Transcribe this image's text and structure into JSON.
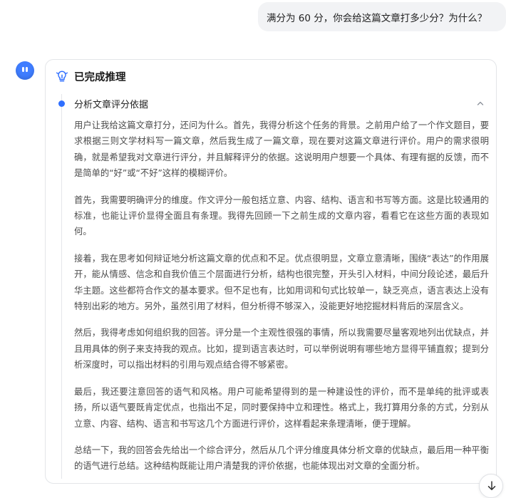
{
  "chat": {
    "user_message": "满分为 60 分，你会给这篇文章打多少分？为什么？"
  },
  "reasoning": {
    "status_title": "已完成推理",
    "step_title": "分析文章评分依据",
    "paragraphs": [
      "用户让我给这篇文章打分，还问为什么。首先，我得分析这个任务的背景。之前用户给了一个作文题目，要求根据三则文学材料写一篇文章，然后我生成了一篇文章，现在要对这篇文章进行评价。用户的需求很明确，就是希望我对文章进行评分，并且解释评分的依据。这说明用户想要一个具体、有理有据的反馈，而不是简单的“好”或“不好”这样的模糊评价。",
      "首先，我需要明确评分的维度。作文评分一般包括立意、内容、结构、语言和书写等方面。这是比较通用的标准，也能让评价显得全面且有条理。我得先回顾一下之前生成的文章内容，看看它在这些方面的表现如何。",
      "接着，我在思考如何辩证地分析这篇文章的优点和不足。优点很明显，文章立意清晰，围绕“表达”的作用展开，能从情感、信念和自我价值三个层面进行分析，结构也很完整，开头引入材料，中间分段论述，最后升华主题。这些都符合作文的基本要求。但不足也有，比如用词和句式比较单一，缺乏亮点，语言表达上没有特别出彩的地方。另外，虽然引用了材料，但分析得不够深入，没能更好地挖掘材料背后的深层含义。",
      "然后，我得考虑如何组织我的回答。评分是一个主观性很强的事情，所以我需要尽量客观地列出优缺点，并且用具体的例子来支持我的观点。比如，提到语言表达时，可以举例说明有哪些地方显得平铺直叙；提到分析深度时，可以指出材料的引用与观点结合得不够紧密。",
      "最后，我还要注意回答的语气和风格。用户可能希望得到的是一种建设性的评价，而不是单纯的批评或表扬，所以语气要既肯定优点，也指出不足，同时要保持中立和理性。格式上，我打算用分条的方式，分别从立意、内容、结构、语言和书写这几个方面进行评价，这样看起来条理清晰，便于理解。",
      "总结一下，我的回答会先给出一个综合评分，然后从几个评分维度具体分析文章的优缺点，最后用一种平衡的语气进行总结。这种结构既能让用户清楚我的评价依据，也能体现出对文章的全面分析。"
    ]
  },
  "icons": {
    "bulb": "lightbulb-icon",
    "collapse": "chevron-up-icon",
    "scroll": "arrow-down-icon"
  },
  "colors": {
    "accent": "#2f6fff",
    "avatar": "#3f7dff",
    "bubble": "#f2f3f5"
  }
}
